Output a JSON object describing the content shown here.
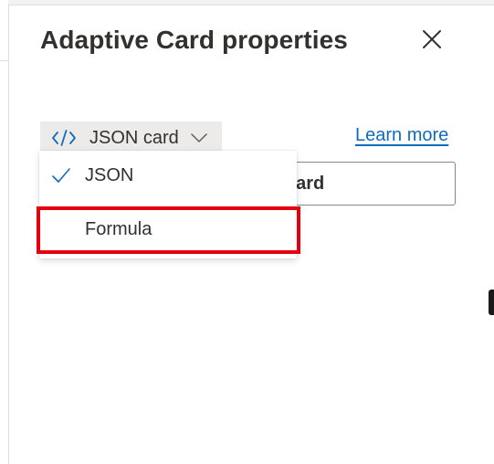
{
  "panel": {
    "title": "Adaptive Card properties",
    "close_icon": "close-icon"
  },
  "mode_selector": {
    "icon": "code-icon",
    "label": "JSON card",
    "chevron_icon": "chevron-down-icon"
  },
  "learn_more": {
    "label": "Learn more"
  },
  "card_input": {
    "visible_value": "card"
  },
  "dropdown": {
    "items": [
      {
        "label": "JSON",
        "selected": true,
        "icon": "checkmark-icon"
      },
      {
        "label": "Formula",
        "selected": false
      }
    ]
  },
  "colors": {
    "accent": "#0f6cbd",
    "highlight": "#e3000f",
    "mode_button_bg": "#edebe9",
    "text": "#323130"
  }
}
